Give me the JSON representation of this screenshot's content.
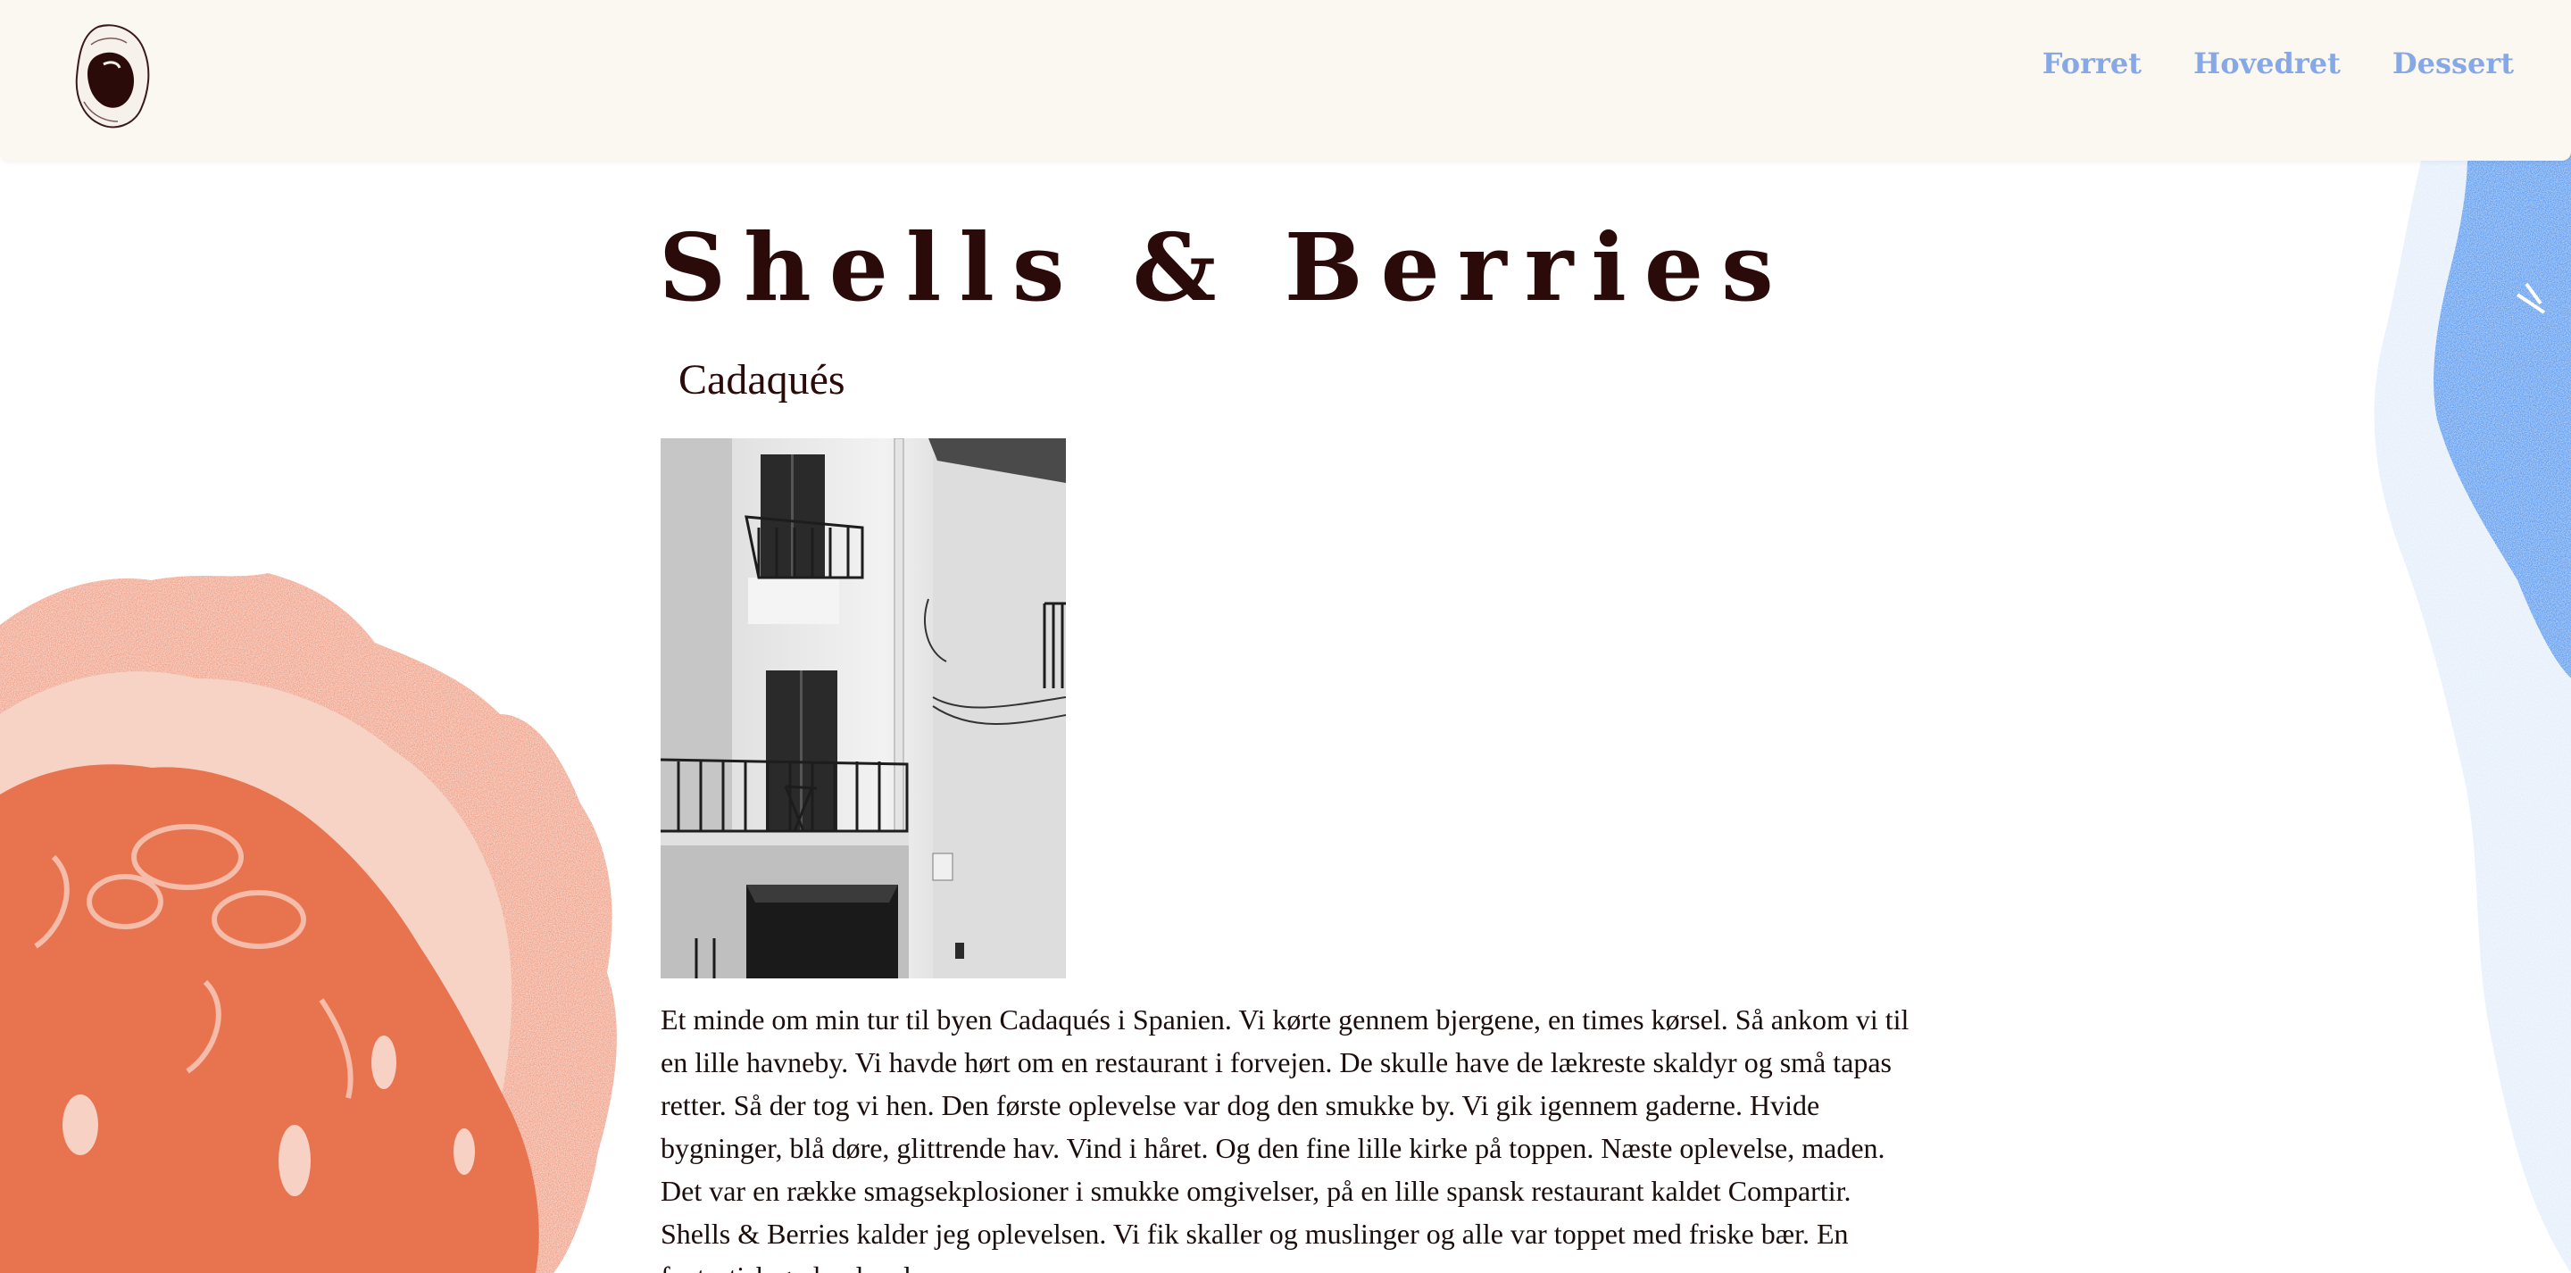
{
  "nav": {
    "items": [
      {
        "label": "Forret"
      },
      {
        "label": "Hovedret"
      },
      {
        "label": "Dessert"
      }
    ]
  },
  "page": {
    "title": "Shells & Berries",
    "subtitle": "Cadaqués",
    "body": "Et minde om min tur til byen Cadaqués i Spanien. Vi kørte gennem bjergene, en times kørsel. Så ankom vi til en lille havneby. Vi havde hørt om en restaurant i forvejen. De skulle have de lækreste skaldyr og små tapas retter. Så der tog vi hen. Den første oplevelse var dog den smukke by. Vi gik igennem gaderne. Hvide bygninger, blå døre, glittrende hav. Vind i håret. Og den fine lille kirke på toppen. Næste oplevelse, maden. Det var en række smagsekplosioner i smukke omgivelser, på en lille spansk restaurant kaldet Compartir. Shells & Berries kalder jeg oplevelsen. Vi fik skaller og muslinger og alle var toppet med friske bær. En fantastisk god oplevelse."
  },
  "colors": {
    "header_bg": "#fbf8f1",
    "nav_link": "#86a8e7",
    "title": "#2b0b0a",
    "coral": "#e8734f",
    "blue": "#5f9cf0"
  },
  "icons": {
    "logo": "oyster-shell-logo"
  }
}
